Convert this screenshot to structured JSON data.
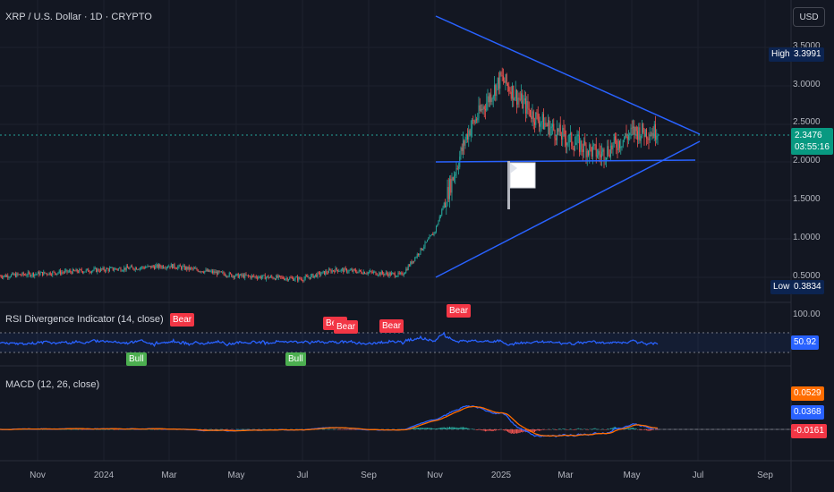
{
  "header": {
    "symbol_title": "XRP / U.S. Dollar · 1D · CRYPTO"
  },
  "currency_button": "USD",
  "price_axis": {
    "ticks": [
      "3.5000",
      "3.0000",
      "2.5000",
      "2.0000",
      "1.5000",
      "1.0000",
      "0.5000"
    ],
    "high_label": "High",
    "high_value": "3.3991",
    "low_label": "Low",
    "low_value": "0.3834",
    "current_price": "2.3476",
    "countdown": "03:55:16"
  },
  "rsi": {
    "title": "RSI Divergence Indicator (14, close)",
    "upper_tick": "100.00",
    "current_value": "50.92",
    "signals": [
      {
        "type": "Bear"
      },
      {
        "type": "Bear"
      },
      {
        "type": "Bear"
      },
      {
        "type": "Bear"
      },
      {
        "type": "Bear"
      },
      {
        "type": "Bull"
      },
      {
        "type": "Bull"
      }
    ]
  },
  "macd": {
    "title": "MACD (12, 26, close)",
    "signal_value": "0.0529",
    "macd_value": "0.0368",
    "hist_value": "-0.0161"
  },
  "time_axis": [
    "Nov",
    "2024",
    "Mar",
    "May",
    "Jul",
    "Sep",
    "Nov",
    "2025",
    "Mar",
    "May",
    "Jul",
    "Sep"
  ],
  "colors": {
    "background": "#131722",
    "trendline": "#2962ff",
    "up": "#26a69a",
    "down": "#ef5350",
    "rsi": "#2962ff",
    "macd_line": "#2962ff",
    "signal_line": "#ff6d00",
    "price_tag": "#089981",
    "tag_dark": "#0c2451"
  },
  "chart_data": {
    "type": "candlestick",
    "symbol": "XRP / U.S. Dollar",
    "interval": "1D",
    "price_range": [
      0.3834,
      3.3991
    ],
    "last_price": 2.3476,
    "approx_close_path": [
      {
        "x": "2023-10",
        "y": 0.52
      },
      {
        "x": "2024-01",
        "y": 0.6
      },
      {
        "x": "2024-03",
        "y": 0.65
      },
      {
        "x": "2024-05",
        "y": 0.52
      },
      {
        "x": "2024-07",
        "y": 0.48
      },
      {
        "x": "2024-08",
        "y": 0.6
      },
      {
        "x": "2024-10",
        "y": 0.53
      },
      {
        "x": "2024-11",
        "y": 1.1
      },
      {
        "x": "2024-12",
        "y": 2.4
      },
      {
        "x": "2025-01",
        "y": 3.1
      },
      {
        "x": "2025-02",
        "y": 2.6
      },
      {
        "x": "2025-03",
        "y": 2.3
      },
      {
        "x": "2025-04",
        "y": 2.1
      },
      {
        "x": "2025-05",
        "y": 2.4
      }
    ]
  }
}
